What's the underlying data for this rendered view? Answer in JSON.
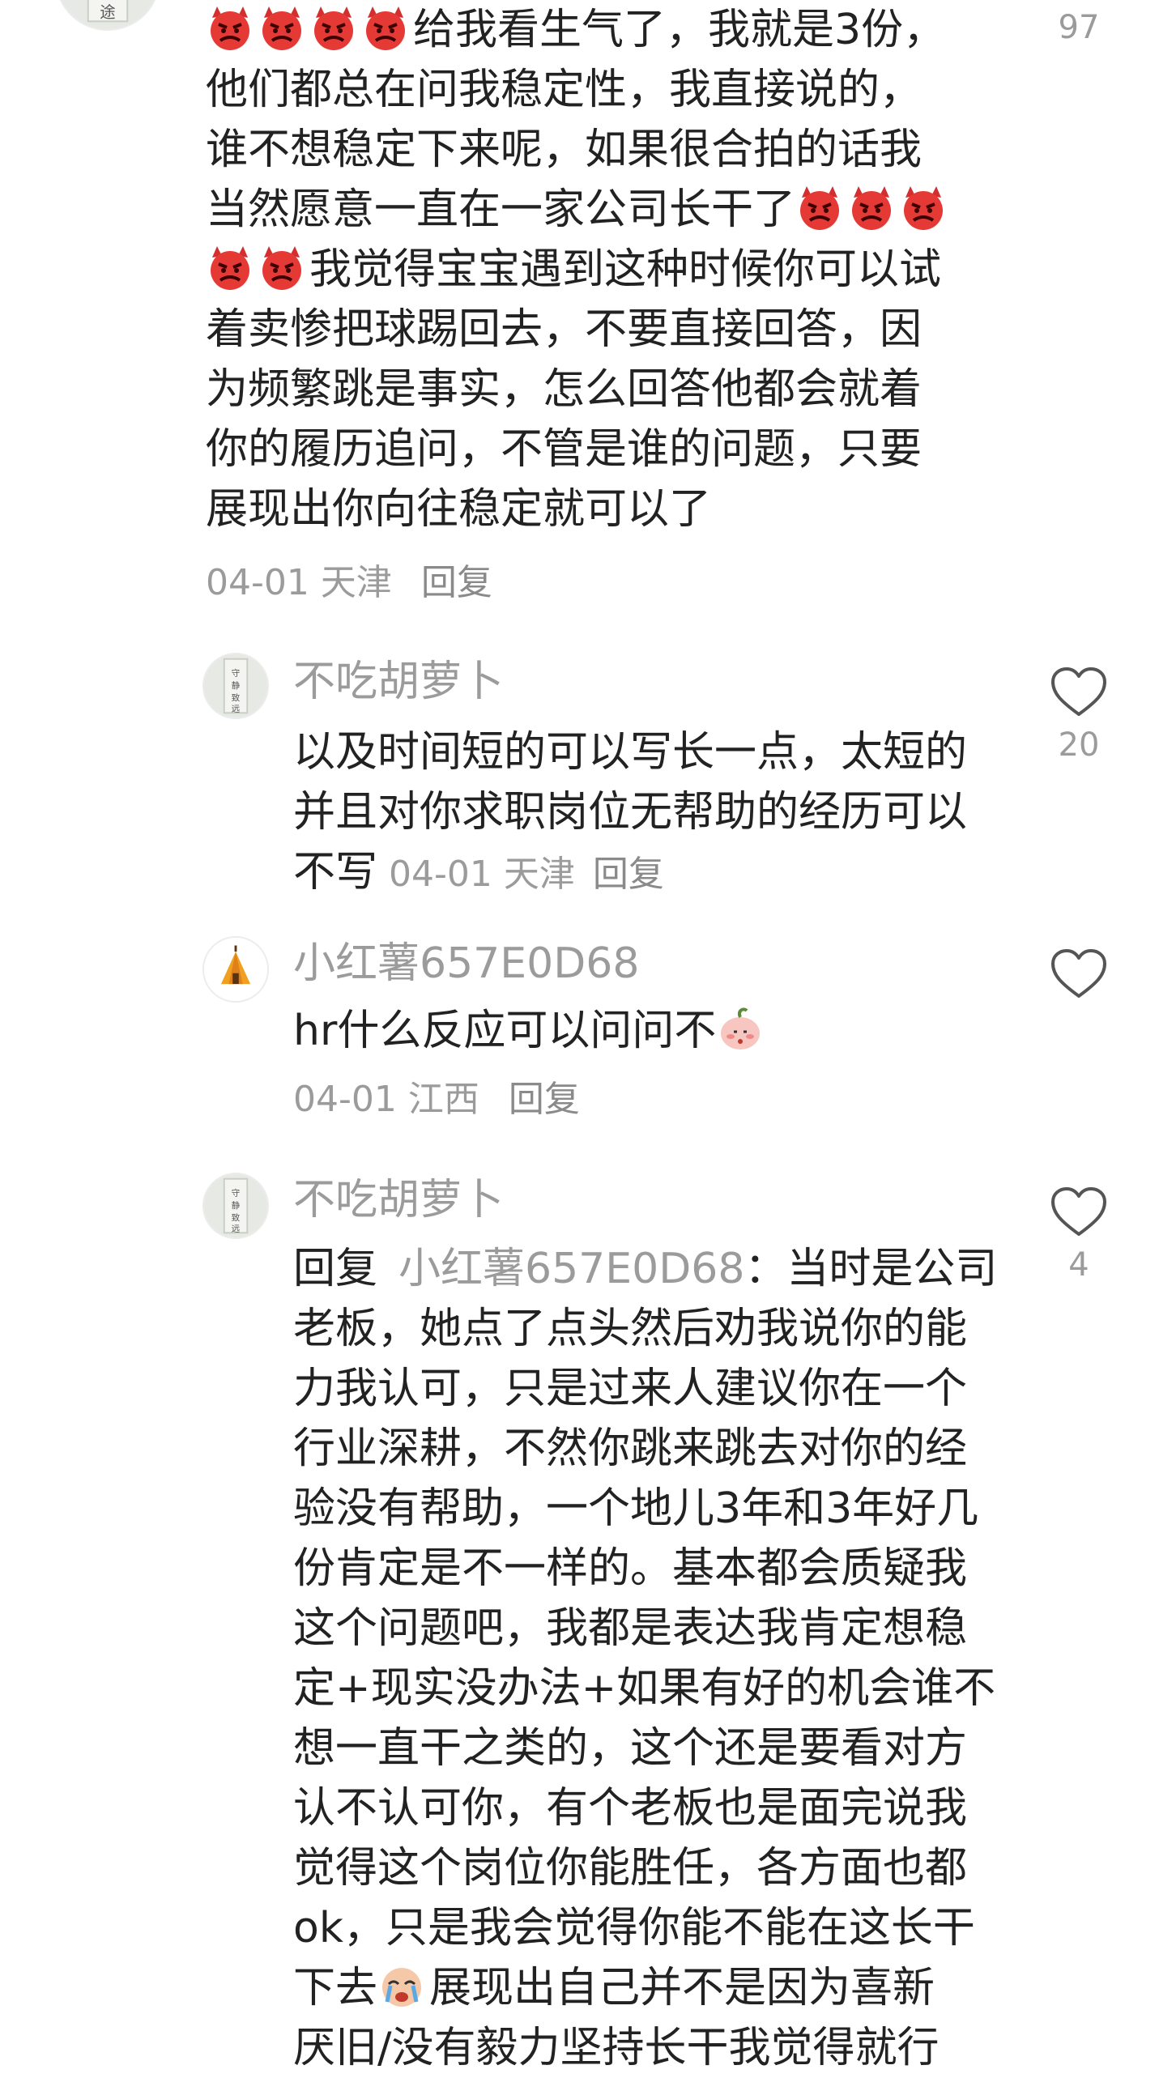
{
  "comments": [
    {
      "lines": [
        "给我看生气了，我就是3份，",
        "他们都总在问我稳定性，我直接说的，",
        "谁不想稳定下来呢，如果很合拍的话我",
        "当然愿意一直在一家公司长干了",
        "我觉得宝宝遇到这种时候你可以试",
        "着卖惨把球踢回去，不要直接回答，因",
        "为频繁跳是事实，怎么回答他都会就着",
        "你的履历追问，不管是谁的问题，只要",
        "展现出你向往稳定就可以了"
      ],
      "date": "04-01",
      "location": "天津",
      "reply_label": "回复",
      "like_count": "97",
      "emoji": "angry-devil"
    },
    {
      "username": "不吃胡萝卜",
      "lines": [
        "以及时间短的可以写长一点，太短的",
        "并且对你求职岗位无帮助的经历可以",
        "不写"
      ],
      "date": "04-01",
      "location": "天津",
      "reply_label": "回复",
      "like_count": "20"
    },
    {
      "username": "小红薯657E0D68",
      "lines": [
        "hr什么反应可以问问不"
      ],
      "date": "04-01",
      "location": "江西",
      "reply_label": "回复",
      "like_count": "",
      "emoji": "shy-peach"
    },
    {
      "username": "不吃胡萝卜",
      "reply_prefix": "回复",
      "mention": "小红薯657E0D68",
      "lines": [
        "：当时是公司",
        "老板，她点了点头然后劝我说你的能",
        "力我认可，只是过来人建议你在一个",
        "行业深耕，不然你跳来跳去对你的经",
        "验没有帮助，一个地儿3年和3年好几",
        "份肯定是不一样的。基本都会质疑我",
        "这个问题吧，我都是表达我肯定想稳",
        "定+现实没办法+如果有好的机会谁不",
        "想一直干之类的，这个还是要看对方",
        "认不认可你，有个老板也是面完说我",
        "觉得这个岗位你能胜任，各方面也都",
        "ok，只是我会觉得你能不能在这长干",
        "下去",
        "展现出自己并不是因为喜新",
        "厌旧/没有毅力坚持长干我觉得就行"
      ],
      "like_count": "4",
      "emoji": "crying-face"
    }
  ],
  "colors": {
    "text": "#222222",
    "meta": "#9b9b9b",
    "emoji_red": "#e53935"
  }
}
